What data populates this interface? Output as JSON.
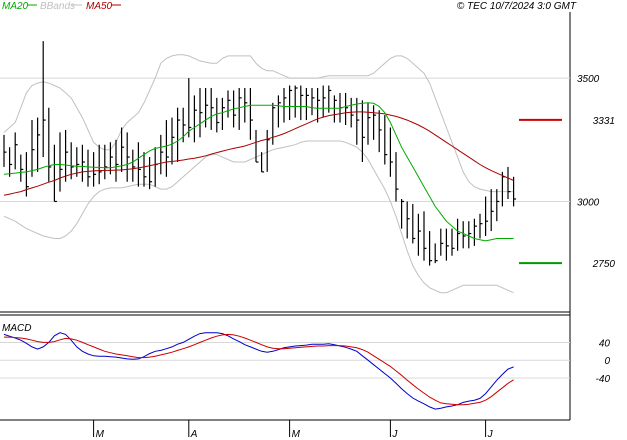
{
  "legend": {
    "ma20": {
      "label": "MA20",
      "color": "#00aa00"
    },
    "bbands": {
      "label": "BBands",
      "color": "#c0c0c0"
    },
    "ma50": {
      "label": "MA50",
      "color": "#aa0000"
    }
  },
  "copyright": "© TEC 10/7/2024 3:0 GMT",
  "macd_label": "MACD",
  "markers": [
    {
      "label": "3331",
      "value": 3331,
      "color": "#cc0000"
    },
    {
      "label": "2750",
      "value": 2750,
      "color": "#009900"
    }
  ],
  "chart_data": [
    {
      "type": "candlestick",
      "title": "",
      "y_ticks": [
        {
          "label": "3500",
          "value": 3500
        },
        {
          "label": "3000",
          "value": 3000
        }
      ],
      "ylim": [
        2560,
        3760
      ],
      "x_ticks": [
        {
          "label": "M",
          "index": 16
        },
        {
          "label": "A",
          "index": 33
        },
        {
          "label": "M",
          "index": 51
        },
        {
          "label": "J",
          "index": 69
        },
        {
          "label": "J",
          "index": 86
        }
      ],
      "grid": true,
      "x_count": 92,
      "close": [
        3200,
        3150,
        3230,
        3130,
        3060,
        3210,
        3270,
        3330,
        3140,
        3000,
        3130,
        3200,
        3140,
        3150,
        3160,
        3100,
        3110,
        3120,
        3140,
        3180,
        3150,
        3220,
        3180,
        3140,
        3130,
        3100,
        3080,
        3150,
        3200,
        3180,
        3260,
        3330,
        3310,
        3300,
        3370,
        3360,
        3390,
        3380,
        3320,
        3380,
        3410,
        3350,
        3420,
        3400,
        3330,
        3160,
        3120,
        3250,
        3380,
        3400,
        3420,
        3450,
        3460,
        3430,
        3430,
        3420,
        3410,
        3420,
        3450,
        3410,
        3380,
        3380,
        3350,
        3330,
        3260,
        3340,
        3350,
        3290,
        3190,
        3160,
        3050,
        3000,
        2930,
        2850,
        2880,
        2810,
        2760,
        2760,
        2830,
        2820,
        2810,
        2870,
        2860,
        2870,
        2900,
        2910,
        2920,
        2960,
        3000,
        3100,
        3040,
        3010
      ],
      "high": [
        3270,
        3220,
        3280,
        3190,
        3200,
        3330,
        3340,
        3650,
        3380,
        3230,
        3280,
        3290,
        3240,
        3220,
        3230,
        3210,
        3200,
        3230,
        3230,
        3240,
        3250,
        3300,
        3280,
        3210,
        3240,
        3200,
        3180,
        3220,
        3270,
        3330,
        3340,
        3380,
        3380,
        3500,
        3430,
        3460,
        3460,
        3460,
        3420,
        3420,
        3450,
        3450,
        3460,
        3460,
        3460,
        3290,
        3200,
        3290,
        3400,
        3430,
        3460,
        3470,
        3470,
        3470,
        3460,
        3460,
        3460,
        3470,
        3470,
        3430,
        3440,
        3440,
        3420,
        3420,
        3410,
        3400,
        3390,
        3370,
        3350,
        3300,
        3200,
        3010,
        3000,
        2990,
        2950,
        2960,
        2880,
        2830,
        2890,
        2890,
        2890,
        2930,
        2920,
        2920,
        2930,
        2950,
        3020,
        3050,
        3050,
        3120,
        3140,
        3100
      ],
      "low": [
        3140,
        3100,
        3130,
        3080,
        3020,
        3100,
        3120,
        3180,
        3080,
        3000,
        3040,
        3080,
        3090,
        3100,
        3080,
        3060,
        3060,
        3070,
        3090,
        3110,
        3080,
        3120,
        3080,
        3080,
        3060,
        3060,
        3050,
        3060,
        3110,
        3100,
        3150,
        3160,
        3240,
        3260,
        3240,
        3260,
        3300,
        3290,
        3280,
        3290,
        3340,
        3300,
        3290,
        3320,
        3250,
        3160,
        3120,
        3120,
        3230,
        3300,
        3320,
        3330,
        3340,
        3330,
        3330,
        3350,
        3320,
        3340,
        3360,
        3320,
        3320,
        3310,
        3300,
        3230,
        3160,
        3230,
        3250,
        3200,
        3150,
        3100,
        3000,
        2890,
        2850,
        2830,
        2780,
        2760,
        2740,
        2750,
        2780,
        2760,
        2780,
        2800,
        2810,
        2810,
        2820,
        2850,
        2860,
        2880,
        2920,
        2980,
        3010,
        2980
      ],
      "ma20": [
        3110,
        3112,
        3115,
        3118,
        3120,
        3125,
        3130,
        3138,
        3145,
        3150,
        3150,
        3148,
        3145,
        3143,
        3142,
        3140,
        3139,
        3138,
        3137,
        3137,
        3140,
        3145,
        3150,
        3160,
        3175,
        3190,
        3205,
        3215,
        3220,
        3225,
        3232,
        3245,
        3262,
        3285,
        3300,
        3315,
        3330,
        3345,
        3355,
        3360,
        3368,
        3375,
        3380,
        3385,
        3390,
        3390,
        3390,
        3390,
        3390,
        3388,
        3385,
        3385,
        3385,
        3385,
        3385,
        3380,
        3378,
        3378,
        3378,
        3378,
        3378,
        3385,
        3390,
        3395,
        3398,
        3400,
        3398,
        3385,
        3360,
        3320,
        3270,
        3220,
        3180,
        3140,
        3100,
        3060,
        3020,
        2980,
        2950,
        2920,
        2900,
        2880,
        2870,
        2860,
        2850,
        2845,
        2840,
        2845,
        2850,
        2850,
        2850,
        2850
      ],
      "ma50": [
        3025,
        3030,
        3035,
        3040,
        3048,
        3055,
        3062,
        3070,
        3078,
        3085,
        3095,
        3103,
        3110,
        3115,
        3120,
        3122,
        3124,
        3125,
        3126,
        3126,
        3127,
        3128,
        3130,
        3133,
        3136,
        3140,
        3145,
        3150,
        3155,
        3160,
        3162,
        3165,
        3168,
        3172,
        3175,
        3180,
        3185,
        3192,
        3198,
        3204,
        3210,
        3215,
        3220,
        3225,
        3232,
        3240,
        3247,
        3253,
        3260,
        3267,
        3275,
        3285,
        3295,
        3305,
        3315,
        3325,
        3335,
        3342,
        3348,
        3352,
        3356,
        3360,
        3362,
        3363,
        3363,
        3362,
        3360,
        3358,
        3355,
        3350,
        3345,
        3338,
        3330,
        3320,
        3310,
        3298,
        3285,
        3270,
        3255,
        3240,
        3225,
        3210,
        3195,
        3180,
        3165,
        3150,
        3137,
        3125,
        3115,
        3105,
        3095,
        3085
      ],
      "bb_upper": [
        3280,
        3300,
        3320,
        3380,
        3440,
        3470,
        3480,
        3485,
        3480,
        3470,
        3460,
        3440,
        3420,
        3380,
        3340,
        3290,
        3240,
        3220,
        3210,
        3210,
        3240,
        3290,
        3320,
        3340,
        3360,
        3400,
        3450,
        3500,
        3560,
        3580,
        3590,
        3595,
        3595,
        3590,
        3580,
        3570,
        3565,
        3560,
        3560,
        3580,
        3590,
        3590,
        3590,
        3590,
        3590,
        3560,
        3540,
        3530,
        3530,
        3520,
        3510,
        3500,
        3500,
        3500,
        3500,
        3500,
        3500,
        3505,
        3510,
        3510,
        3510,
        3510,
        3510,
        3510,
        3510,
        3510,
        3520,
        3540,
        3560,
        3580,
        3590,
        3590,
        3580,
        3560,
        3540,
        3520,
        3480,
        3420,
        3360,
        3300,
        3240,
        3180,
        3120,
        3080,
        3060,
        3050,
        3045,
        3040,
        3040,
        3040,
        3040,
        3040
      ],
      "bb_lower": [
        2940,
        2930,
        2920,
        2905,
        2890,
        2880,
        2870,
        2860,
        2855,
        2850,
        2850,
        2860,
        2880,
        2910,
        2950,
        2990,
        3020,
        3040,
        3050,
        3055,
        3055,
        3055,
        3060,
        3065,
        3070,
        3070,
        3070,
        3060,
        3050,
        3050,
        3060,
        3080,
        3100,
        3120,
        3140,
        3160,
        3180,
        3190,
        3190,
        3180,
        3170,
        3160,
        3160,
        3160,
        3170,
        3180,
        3190,
        3200,
        3210,
        3215,
        3220,
        3225,
        3230,
        3240,
        3245,
        3245,
        3245,
        3245,
        3245,
        3245,
        3245,
        3240,
        3230,
        3220,
        3200,
        3170,
        3130,
        3090,
        3050,
        3000,
        2940,
        2870,
        2800,
        2740,
        2700,
        2670,
        2650,
        2640,
        2630,
        2630,
        2640,
        2650,
        2660,
        2660,
        2660,
        2660,
        2660,
        2660,
        2660,
        2650,
        2640,
        2630
      ]
    },
    {
      "type": "line",
      "title": "MACD",
      "y_ticks": [
        {
          "label": "40",
          "value": 40
        },
        {
          "label": "0",
          "value": 0
        },
        {
          "label": "-40",
          "value": -40
        }
      ],
      "ylim": [
        -130,
        95
      ],
      "x_count": 92,
      "series": [
        {
          "name": "",
          "color": "#0000cc",
          "values": [
            58,
            54,
            50,
            45,
            38,
            30,
            25,
            30,
            40,
            55,
            62,
            58,
            45,
            30,
            20,
            14,
            10,
            9,
            9,
            8,
            7,
            5,
            3,
            2,
            3,
            8,
            15,
            20,
            22,
            26,
            30,
            36,
            40,
            47,
            54,
            60,
            62,
            62,
            62,
            60,
            55,
            48,
            42,
            35,
            30,
            25,
            20,
            18,
            20,
            24,
            28,
            30,
            32,
            33,
            34,
            36,
            36,
            36,
            37,
            35,
            32,
            29,
            25,
            20,
            10,
            0,
            -10,
            -20,
            -30,
            -40,
            -52,
            -64,
            -75,
            -85,
            -92,
            -98,
            -105,
            -110,
            -108,
            -105,
            -103,
            -100,
            -95,
            -92,
            -90,
            -86,
            -75,
            -60,
            -45,
            -32,
            -20,
            -15
          ]
        },
        {
          "name": "",
          "color": "#cc0000",
          "values": [
            52,
            52,
            51,
            50,
            48,
            45,
            42,
            40,
            40,
            42,
            46,
            49,
            48,
            45,
            40,
            35,
            30,
            25,
            20,
            17,
            14,
            12,
            10,
            8,
            6,
            6,
            7,
            9,
            12,
            15,
            18,
            22,
            26,
            30,
            35,
            40,
            45,
            50,
            54,
            57,
            58,
            57,
            54,
            50,
            45,
            40,
            35,
            30,
            27,
            26,
            26,
            27,
            28,
            29,
            30,
            31,
            32,
            32,
            33,
            33,
            33,
            32,
            30,
            28,
            24,
            18,
            10,
            2,
            -6,
            -14,
            -24,
            -34,
            -45,
            -55,
            -65,
            -74,
            -83,
            -90,
            -96,
            -98,
            -99,
            -100,
            -100,
            -99,
            -97,
            -95,
            -90,
            -82,
            -72,
            -62,
            -52,
            -44
          ]
        }
      ]
    }
  ]
}
